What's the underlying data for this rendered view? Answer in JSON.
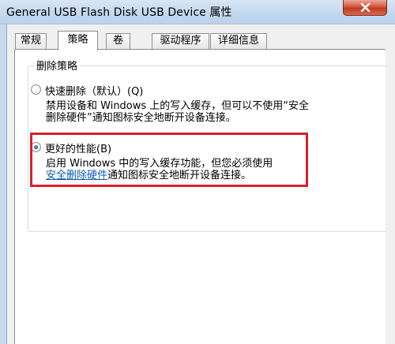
{
  "window": {
    "title": "General USB Flash Disk USB Device 属性"
  },
  "tabs": [
    {
      "label": "常规",
      "active": false
    },
    {
      "label": "策略",
      "active": true
    },
    {
      "label": "卷",
      "active": false
    },
    {
      "label": "驱动程序",
      "active": false
    },
    {
      "label": "详细信息",
      "active": false
    }
  ],
  "removal_policy": {
    "group_title": "删除策略",
    "options": [
      {
        "label": "快速删除（默认）(Q)",
        "selected": false,
        "desc_line1": "禁用设备和 Windows 上的写入缓存，但可以不使用“安全",
        "desc_line2": "删除硬件”通知图标安全地断开设备连接。"
      },
      {
        "label": "更好的性能(B)",
        "selected": true,
        "desc_line1": "启用 Windows 中的写入缓存功能，但您必须使用",
        "link_text": "安全删除硬件",
        "desc_line2_rest": "通知图标安全地断开设备连接。"
      }
    ]
  },
  "colors": {
    "highlight_box": "#d8202b",
    "link": "#0f5bb5",
    "title_bar": "#c4d8ee",
    "close_button": "#c23a1f"
  },
  "icons": {
    "close": "close-icon"
  }
}
